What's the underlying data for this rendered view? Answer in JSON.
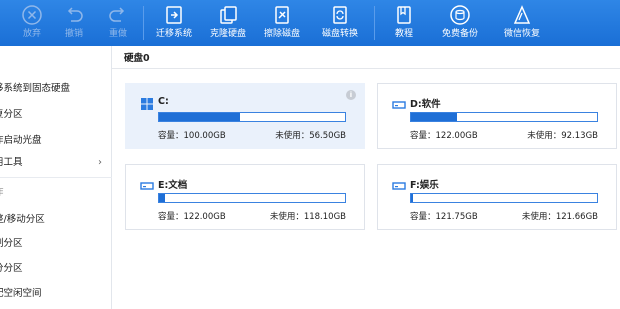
{
  "toolbar": {
    "buttons": [
      {
        "label": "放弃",
        "icon": "close-circle-icon",
        "disabled": true
      },
      {
        "label": "撤销",
        "icon": "undo-icon",
        "disabled": true
      },
      {
        "label": "重做",
        "icon": "redo-icon",
        "disabled": true
      },
      {
        "label": "迁移系统",
        "icon": "migrate-os-icon",
        "disabled": false
      },
      {
        "label": "克隆硬盘",
        "icon": "clone-disk-icon",
        "disabled": false
      },
      {
        "label": "擦除磁盘",
        "icon": "wipe-disk-icon",
        "disabled": false
      },
      {
        "label": "磁盘转换",
        "icon": "convert-disk-icon",
        "disabled": false
      },
      {
        "label": "教程",
        "icon": "tutorial-icon",
        "disabled": false
      },
      {
        "label": "免费备份",
        "icon": "backup-icon",
        "disabled": false
      },
      {
        "label": "微信恢复",
        "icon": "recover-icon",
        "disabled": false
      }
    ]
  },
  "sidebar": {
    "items": [
      {
        "label": "移系统到固态硬盘"
      },
      {
        "label": "复分区"
      },
      {
        "label": "作启动光盘"
      },
      {
        "label": "用工具"
      },
      {
        "label": "作"
      },
      {
        "label": "整/移动分区"
      },
      {
        "label": "制分区"
      },
      {
        "label": "分分区"
      },
      {
        "label": "配空闲空间"
      }
    ]
  },
  "main": {
    "disk_title": "硬盘0",
    "partitions": [
      {
        "name": "C:",
        "os_icon": "windows-icon",
        "capacity": "容量：100.00GB",
        "free": "未使用：56.50GB",
        "used_ratio": 0.435,
        "selected": true
      },
      {
        "name": "D:软件",
        "os_icon": "drive-icon",
        "capacity": "容量：122.00GB",
        "free": "未使用：92.13GB",
        "used_ratio": 0.245,
        "selected": false
      },
      {
        "name": "E:文档",
        "os_icon": "drive-icon",
        "capacity": "容量：122.00GB",
        "free": "未使用：118.10GB",
        "used_ratio": 0.032,
        "selected": false
      },
      {
        "name": "F:娱乐",
        "os_icon": "drive-icon",
        "capacity": "容量：121.75GB",
        "free": "未使用：121.66GB",
        "used_ratio": 0.01,
        "selected": false
      }
    ]
  },
  "colors": {
    "toolbar_bg": "#1a6fd6",
    "progress_fill": "#1f6fd6",
    "selected_card_bg": "#eaf1fb"
  }
}
